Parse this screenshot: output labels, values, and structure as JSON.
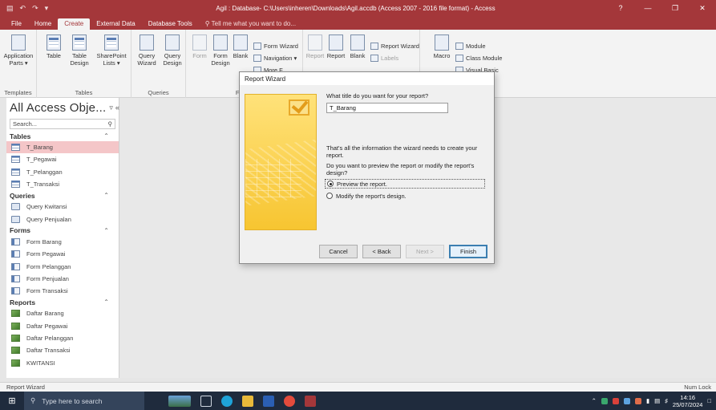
{
  "titlebar": {
    "title": "Agil : Database- C:\\Users\\inheren\\Downloads\\Agil.accdb (Access 2007 - 2016 file format) - Access",
    "help": "?",
    "minimize": "—",
    "restore": "❐",
    "close": "✕"
  },
  "menu": {
    "tabs": [
      "File",
      "Home",
      "Create",
      "External Data",
      "Database Tools"
    ],
    "active_tab": "Create",
    "tell_me": "Tell me what you want to do..."
  },
  "ribbon": {
    "templates": {
      "label": "Templates",
      "application_parts": "Application Parts ▾"
    },
    "tables": {
      "label": "Tables",
      "table": "Table",
      "table_design": "Table Design",
      "sharepoint_lists": "SharePoint Lists ▾"
    },
    "queries": {
      "label": "Queries",
      "query_wizard": "Query Wizard",
      "query_design": "Query Design"
    },
    "forms": {
      "label": "Forms",
      "form": "Form",
      "form_design": "Form Design",
      "blank": "Blank",
      "form_wizard": "Form Wizard",
      "navigation": "Navigation ▾",
      "more_forms": "More F..."
    },
    "reports": {
      "label": "Reports",
      "report": "Report",
      "report_design": "Report",
      "blank": "Blank",
      "report_wizard": "Report Wizard",
      "labels": "Labels"
    },
    "macros": {
      "macro": "Macro",
      "module": "Module",
      "class_module": "Class Module",
      "visual_basic": "Visual Basic"
    }
  },
  "nav": {
    "title": "All Access Obje...",
    "search_placeholder": "Search...",
    "sections": [
      {
        "name": "Tables",
        "items": [
          "T_Barang",
          "T_Pegawai",
          "T_Pelanggan",
          "T_Transaksi"
        ]
      },
      {
        "name": "Queries",
        "items": [
          "Query Kwitansi",
          "Query Penjualan"
        ]
      },
      {
        "name": "Forms",
        "items": [
          "Form Barang",
          "Form Pegawai",
          "Form Pelanggan",
          "Form Penjualan",
          "Form Transaksi"
        ]
      },
      {
        "name": "Reports",
        "items": [
          "Daftar Barang",
          "Daftar Pegawai",
          "Daftar Pelanggan",
          "Daftar Transaksi",
          "KWITANSI"
        ]
      }
    ],
    "selected": "T_Barang"
  },
  "dialog": {
    "title": "Report Wizard",
    "question": "What title do you want for your report?",
    "title_value": "T_Barang",
    "info": "That's all the information the wizard needs to create your report.",
    "question2": "Do you want to preview the report or modify the report's design?",
    "option_preview": "Preview the report.",
    "option_modify": "Modify the report's design.",
    "selected_option": "preview",
    "buttons": {
      "cancel": "Cancel",
      "back": "< Back",
      "next": "Next >",
      "finish": "Finish"
    }
  },
  "statusbar": {
    "left": "Report Wizard",
    "right": "Num Lock"
  },
  "taskbar": {
    "search_placeholder": "Type here to search",
    "time": "14:16",
    "date": "25/07/2024"
  },
  "colors": {
    "accent": "#a4373a",
    "selected_item": "#f4c6c8",
    "taskbar": "#1f2b3d",
    "wizard_art": "#f7c531"
  }
}
